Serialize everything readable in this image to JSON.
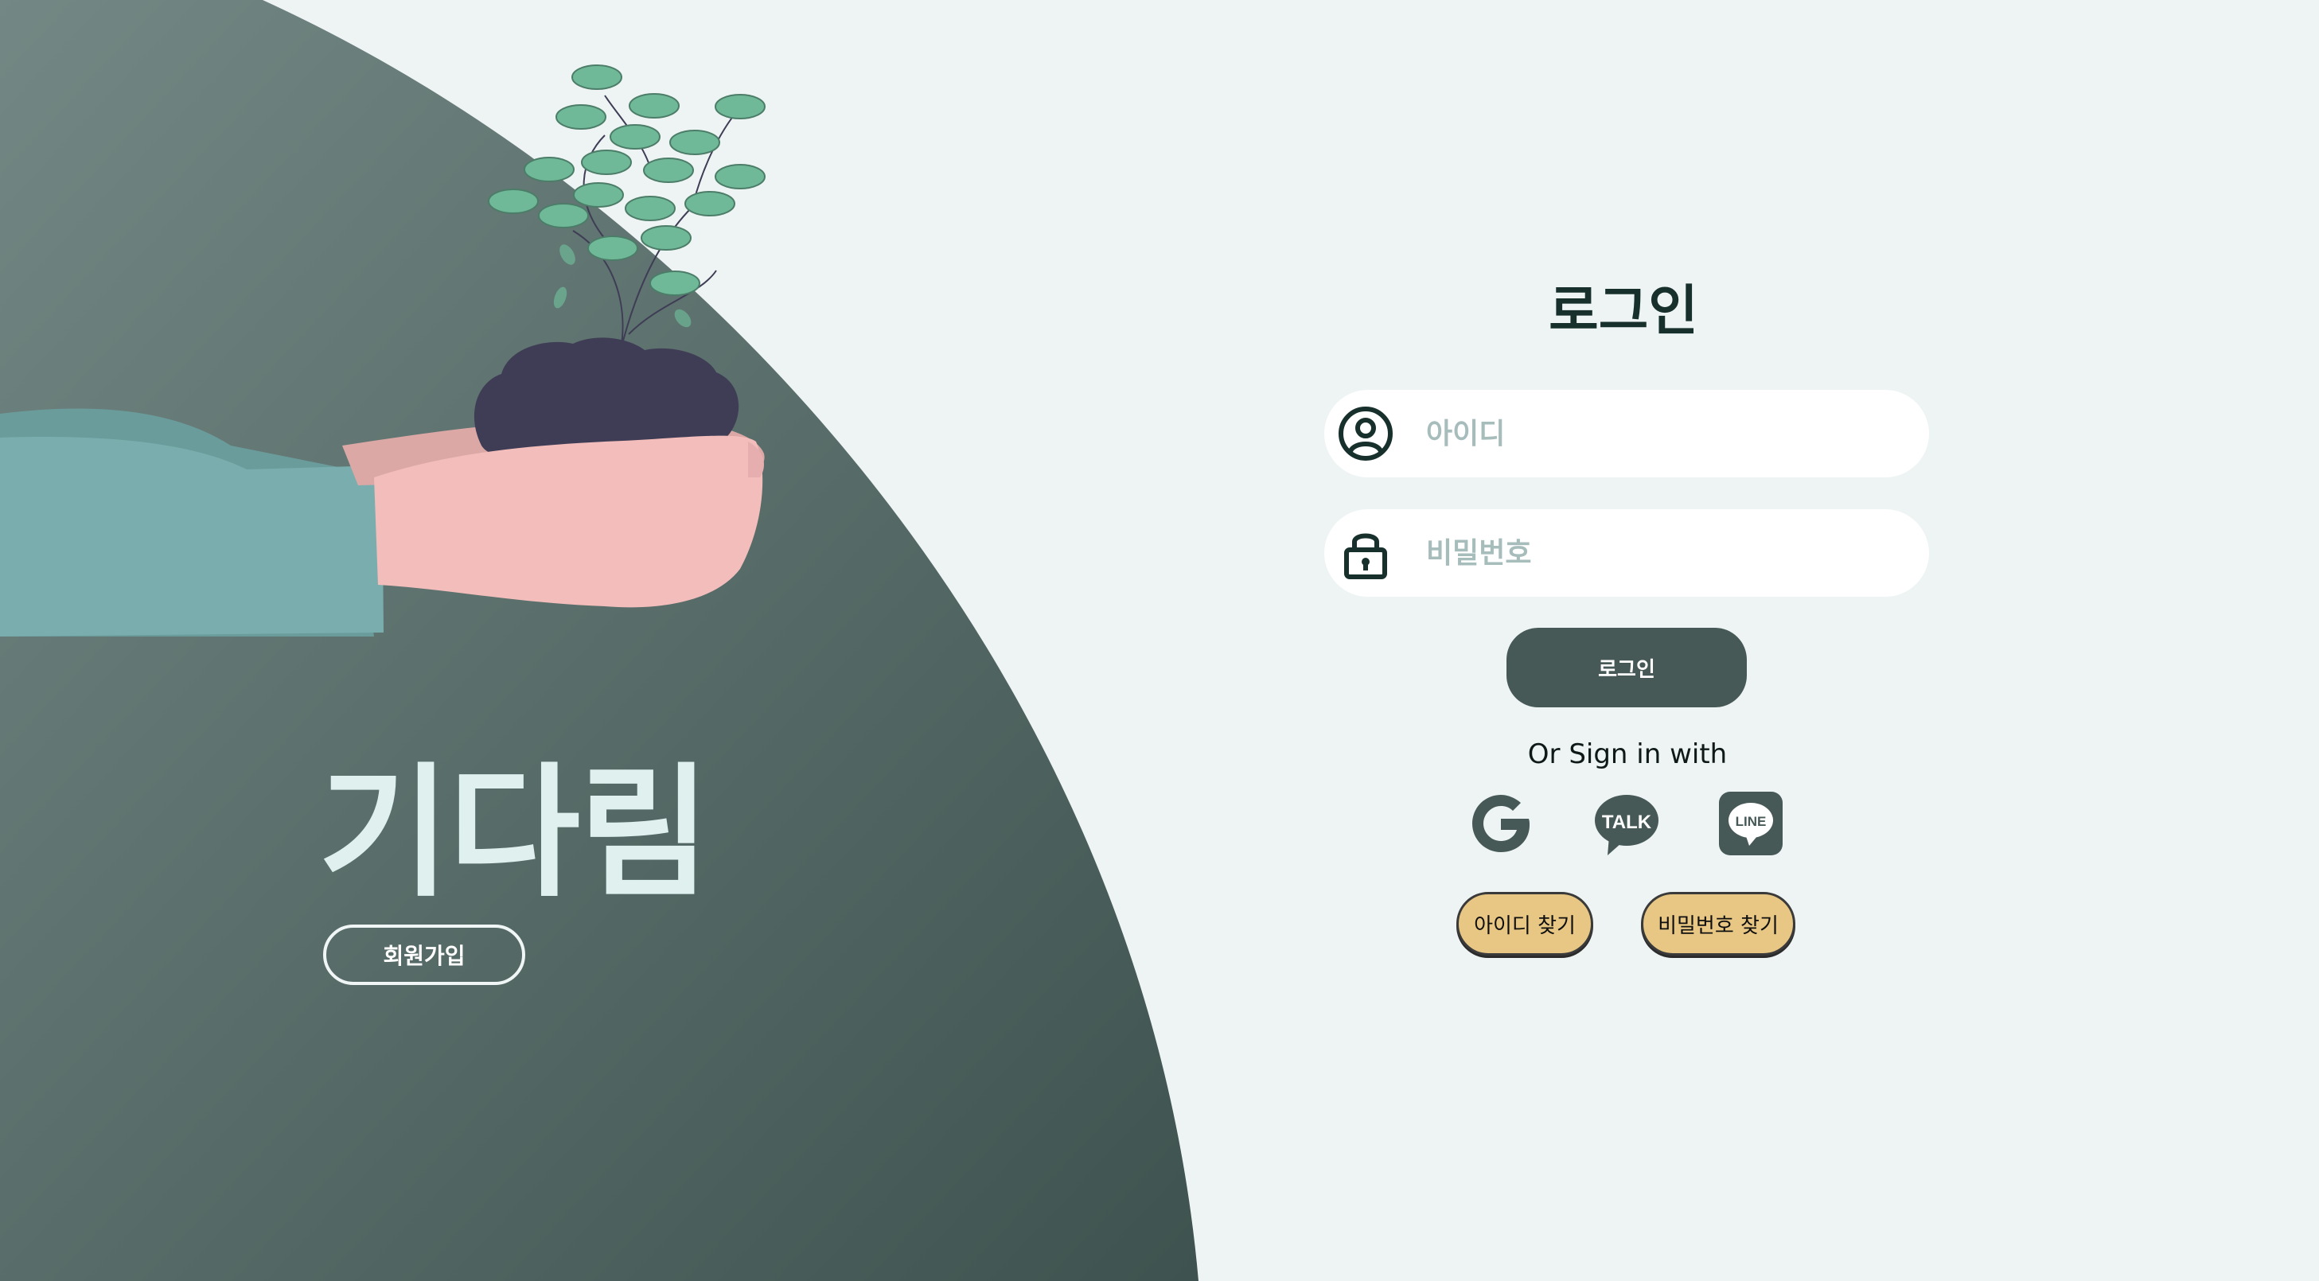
{
  "hero": {
    "brand_title": "기다림",
    "signup_label": "회원가입"
  },
  "login": {
    "title": "로그인",
    "id_placeholder": "아이디",
    "password_placeholder": "비밀번호",
    "submit_label": "로그인",
    "social_heading": "Or Sign in with",
    "social": [
      {
        "name": "google",
        "icon": "google-icon"
      },
      {
        "name": "kakaotalk",
        "icon": "kakaotalk-icon",
        "badge": "TALK"
      },
      {
        "name": "line",
        "icon": "line-icon",
        "badge": "LINE"
      }
    ],
    "find_id_label": "아이디 찾기",
    "find_password_label": "비밀번호 찾기"
  },
  "colors": {
    "page_bg": "#eef4f4",
    "hero_dark": "#3e524f",
    "hero_light": "#738784",
    "primary_button": "#465957",
    "accent_button": "#e8c784",
    "leaf": "#6fb898",
    "sleeve": "#7aaeae",
    "hand": "#f2bdbb",
    "soil": "#3f3d55"
  }
}
